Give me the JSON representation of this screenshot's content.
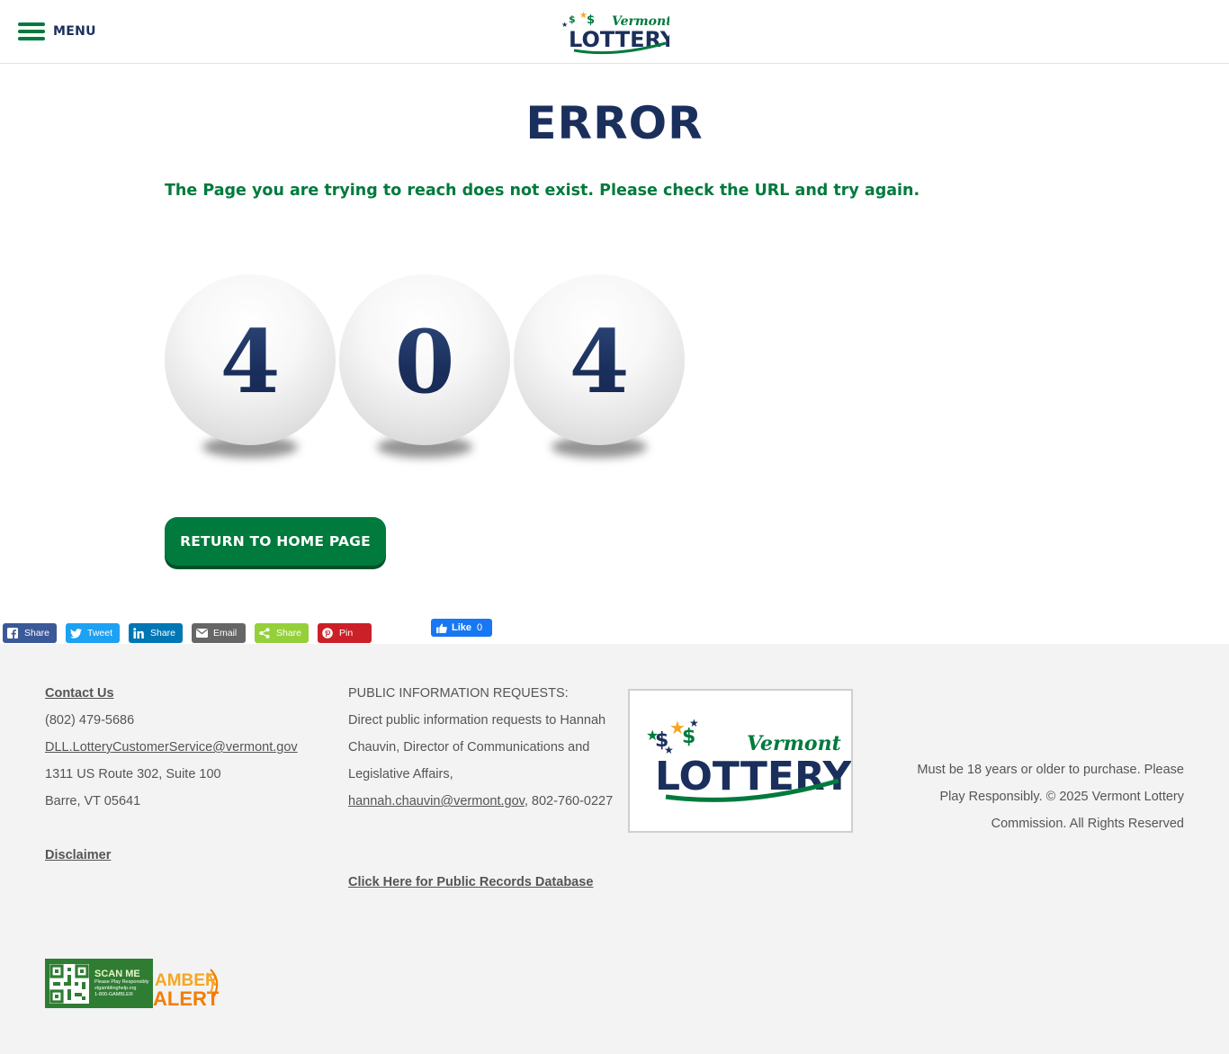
{
  "header": {
    "menu_label": "MENU",
    "logo_top": "Vermont",
    "logo_bottom": "LOTTERY"
  },
  "main": {
    "title": "ERROR",
    "message": "The Page you are trying to reach does not exist. Please check the URL and try again.",
    "digits": [
      "4",
      "0",
      "4"
    ],
    "home_button": "RETURN TO HOME PAGE"
  },
  "share": {
    "buttons": [
      {
        "label": "Share",
        "icon": "facebook-icon",
        "color": "#3b5998"
      },
      {
        "label": "Tweet",
        "icon": "twitter-icon",
        "color": "#1da1f2"
      },
      {
        "label": "Share",
        "icon": "linkedin-icon",
        "color": "#0077b5"
      },
      {
        "label": "Email",
        "icon": "email-icon",
        "color": "#666666"
      },
      {
        "label": "Share",
        "icon": "share-icon",
        "color": "#95d03a"
      },
      {
        "label": "Pin",
        "icon": "pinterest-icon",
        "color": "#cb2027"
      }
    ],
    "like_label": "Like",
    "like_count": "0"
  },
  "footer": {
    "contact_label": "Contact Us",
    "phone": "(802) 479-5686",
    "email": "DLL.LotteryCustomerService@vermont.gov",
    "address_line1": "1311 US Route 302, Suite 100",
    "address_line2": "Barre, VT 05641",
    "disclaimer": "Disclaimer",
    "pir_heading": "PUBLIC INFORMATION REQUESTS:",
    "pir_text": "Direct public information requests to Hannah Chauvin, Director of Communications and Legislative Affairs,",
    "pir_email": "hannah.chauvin@vermont.gov",
    "pir_phone": ", 802-760-0227",
    "records_link": "Click Here for Public Records Database",
    "legal": "Must be 18 years or older to purchase. Please Play Responsibly. © 2025 Vermont Lottery Commission. All Rights Reserved",
    "qr_scan": "SCAN ME",
    "qr_line1": "Please Play Responsibly",
    "qr_line2": "vtgamblinghelp.org",
    "qr_line3": "1-800-GAMBLER",
    "amber_top": "AMBER",
    "amber_bottom": "ALERT"
  },
  "colors": {
    "brand_green": "#007a3d",
    "brand_navy": "#1b2f5c",
    "footer_bg": "#f3f3f3"
  }
}
